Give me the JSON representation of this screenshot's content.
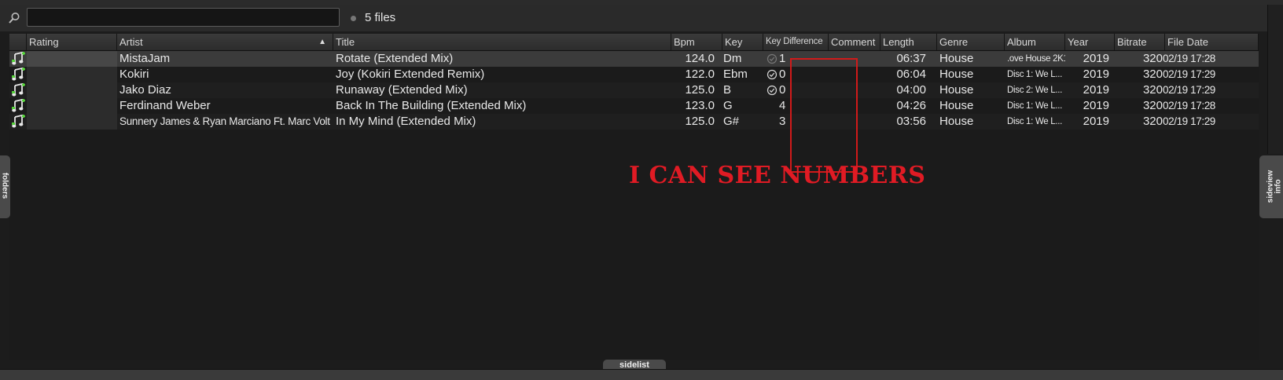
{
  "search": {
    "placeholder": "",
    "value": ""
  },
  "file_count": "5 files",
  "columns": [
    "Rating",
    "Artist",
    "Title",
    "Bpm",
    "Key",
    "Key Difference",
    "Comment",
    "Length",
    "Genre",
    "Album",
    "Year",
    "Bitrate",
    "File Date"
  ],
  "sorted_column": "Artist",
  "rows": [
    {
      "artist": "MistaJam",
      "title": "Rotate (Extended Mix)",
      "bpm": "124.0",
      "key": "Dm",
      "key_diff": "1",
      "comment": "",
      "length": "06:37",
      "genre": "House",
      "album": ".ove House 2K1",
      "year": "2019",
      "bitrate": "320",
      "file_date": "02/19 17:28",
      "key_check": "faded"
    },
    {
      "artist": "Kokiri",
      "title": "Joy (Kokiri Extended Remix)",
      "bpm": "122.0",
      "key": "Ebm",
      "key_diff": "0",
      "comment": "",
      "length": "06:04",
      "genre": "House",
      "album": "Disc 1: We L...",
      "year": "2019",
      "bitrate": "320",
      "file_date": "02/19 17:29",
      "key_check": "match"
    },
    {
      "artist": "Jako Diaz",
      "title": "Runaway (Extended Mix)",
      "bpm": "125.0",
      "key": "B",
      "key_diff": "0",
      "comment": "",
      "length": "04:00",
      "genre": "House",
      "album": "Disc 2: We L...",
      "year": "2019",
      "bitrate": "320",
      "file_date": "02/19 17:29",
      "key_check": "match"
    },
    {
      "artist": "Ferdinand Weber",
      "title": "Back In The Building (Extended Mix)",
      "bpm": "123.0",
      "key": "G",
      "key_diff": "4",
      "comment": "",
      "length": "04:26",
      "genre": "House",
      "album": "Disc 1: We L...",
      "year": "2019",
      "bitrate": "320",
      "file_date": "02/19 17:28",
      "key_check": "none"
    },
    {
      "artist": "Sunnery James & Ryan Marciano Ft. Marc Volt",
      "title": "In My Mind (Extended Mix)",
      "bpm": "125.0",
      "key": "G#",
      "key_diff": "3",
      "comment": "",
      "length": "03:56",
      "genre": "House",
      "album": "Disc 1: We L...",
      "year": "2019",
      "bitrate": "320",
      "file_date": "02/19 17:29",
      "key_check": "none"
    }
  ],
  "annotation": "I CAN SEE NUMBERS",
  "side_tabs": {
    "left": "folders",
    "right_1": "sideview",
    "right_2": "info",
    "bottom": "sidelist"
  },
  "colors": {
    "annotation": "#e01b24",
    "music_icon_green": "#55d13a"
  }
}
